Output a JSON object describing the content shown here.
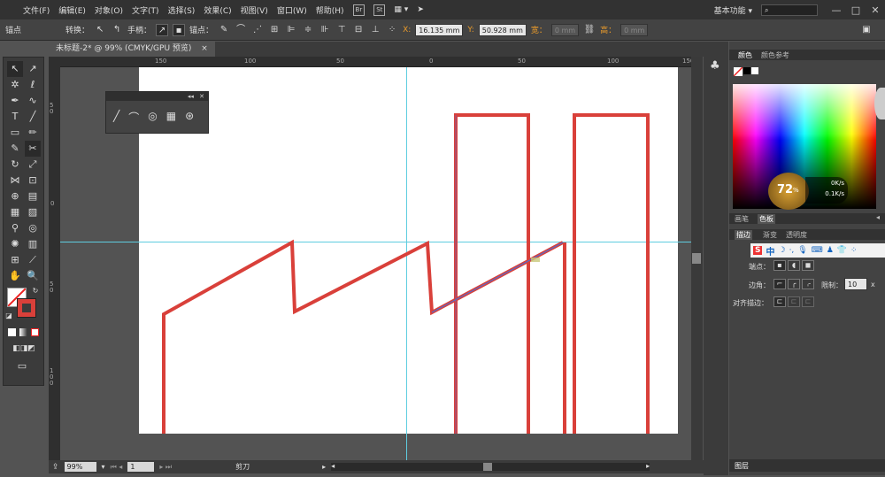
{
  "menubar": {
    "items": [
      "文件(F)",
      "编辑(E)",
      "对象(O)",
      "文字(T)",
      "选择(S)",
      "效果(C)",
      "视图(V)",
      "窗口(W)",
      "帮助(H)"
    ],
    "badge_br": "Br",
    "badge_st": "St",
    "workspace": "基本功能",
    "window_controls": [
      "—",
      "□",
      "✕"
    ]
  },
  "control_bar": {
    "anchor_label": "锚点",
    "convert_label": "转换：",
    "handle_label": "手柄：",
    "anchors_label": "锚点：",
    "x_label": "X:",
    "x_value": "16.135 mm",
    "y_label": "Y:",
    "y_value": "50.928 mm",
    "width_label": "宽：",
    "width_value": "0 mm",
    "height_label": "高：",
    "height_value": "0 mm"
  },
  "document": {
    "tab_title": "未标题-2* @ 99% (CMYK/GPU 预览)",
    "close": "×",
    "hruler_ticks": [
      "150",
      "100",
      "50",
      "0",
      "50",
      "100",
      "150"
    ],
    "vruler_ticks": [
      "5 0",
      "0",
      "5 0",
      "1 0 0"
    ]
  },
  "statusbar": {
    "zoom": "99%",
    "page": "1",
    "tool_name": "剪刀"
  },
  "float_panel": {
    "controls": [
      "◂◂",
      "✕"
    ]
  },
  "right_panel": {
    "tabs_color": [
      "颜色",
      "颜色参考"
    ],
    "tabs_mid": [
      "画笔",
      "色板"
    ],
    "tabs_stroke": [
      "描边",
      "渐变",
      "透明度"
    ],
    "net_speed_up": "0K/s",
    "net_speed_down": "0.1K/s",
    "badge": "72",
    "badge_unit": "%",
    "stroke_ends_label": "端点：",
    "corner_label": "边角：",
    "limit_label": "限制：",
    "limit_value": "10",
    "limit_suffix": "x",
    "align_label": "对齐描边：",
    "layers_tab": "图层",
    "ime_chars": [
      "中",
      "·,",
      "⌨"
    ]
  },
  "colors": {
    "path_red": "#d9403a",
    "guide_cyan": "#5fcde0",
    "selection_blue": "#4a6fd8",
    "ui_dark": "#323232",
    "ui_mid": "#434343",
    "orange_labels": "#e89a2b"
  }
}
